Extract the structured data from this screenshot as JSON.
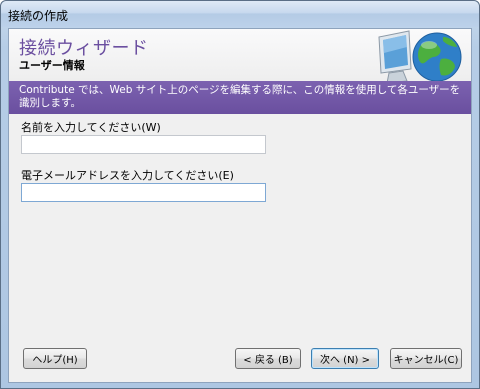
{
  "window": {
    "title": "接続の作成"
  },
  "header": {
    "title": "接続ウィザード",
    "subtitle": "ユーザー情報",
    "logo_icon": "computer-globe-icon"
  },
  "banner": {
    "text": "Contribute では、Web サイト上のページを編集する際に、この情報を使用して各ユーザーを識別します。"
  },
  "form": {
    "name_label": "名前を入力してください(W)",
    "name_value": "",
    "email_label": "電子メールアドレスを入力してください(E)",
    "email_value": ""
  },
  "buttons": {
    "help": "ヘルプ(H)",
    "back": "< 戻る (B)",
    "next": "次へ (N) >",
    "cancel": "キャンセル(C)"
  },
  "colors": {
    "accent_purple": "#6a4f9f",
    "title_purple": "#6b4fa0"
  }
}
